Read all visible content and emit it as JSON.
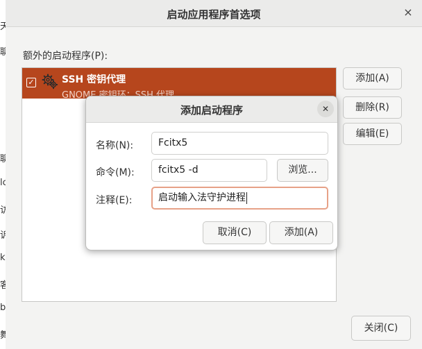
{
  "background_glyphs": [
    "天",
    "聊",
    "访",
    "lc",
    "赖",
    "诉",
    "k",
    "客",
    "b",
    "舞"
  ],
  "main_window": {
    "title": "启动应用程序首选项",
    "close_symbol": "×",
    "section_label": "额外的启动程序(P):",
    "startup_items": [
      {
        "title": "SSH 密钥代理",
        "subtitle": "GNOME 密钥环：SSH 代理",
        "checked": true
      }
    ],
    "check_symbol": "✓",
    "buttons": {
      "add": "添加(A)",
      "remove": "删除(R)",
      "edit": "编辑(E)",
      "close": "关闭(C)"
    }
  },
  "dialog": {
    "title": "添加启动程序",
    "close_symbol": "✕",
    "fields": {
      "name": {
        "label": "名称(N):",
        "value": "Fcitx5"
      },
      "command": {
        "label": "命令(M):",
        "value": "fcitx5 -d"
      },
      "comment": {
        "label": "注释(E):",
        "value": "启动输入法守护进程"
      }
    },
    "browse_label": "浏览...",
    "cancel_label": "取消(C)",
    "add_label": "添加(A)"
  },
  "colors": {
    "selection": "#b6461d",
    "focus_border": "#e7a187"
  }
}
